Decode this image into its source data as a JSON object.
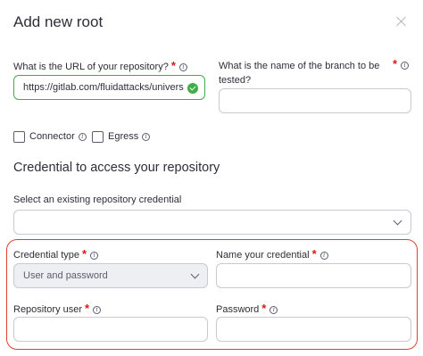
{
  "dialog": {
    "title": "Add new root"
  },
  "repo_url": {
    "label": "What is the URL of your repository?",
    "value": "https://gitlab.com/fluidattacks/universe",
    "required_mark": "*"
  },
  "branch": {
    "label_line1": "What is the name of the branch to be",
    "label_line2": "tested?",
    "value": "",
    "required_mark": "*"
  },
  "options": {
    "connector_label": "Connector",
    "egress_label": "Egress"
  },
  "credential_section": {
    "title": "Credential to access your repository",
    "existing_label": "Select an existing repository credential",
    "existing_value": ""
  },
  "credential_type": {
    "label": "Credential type",
    "value": "User and password",
    "required_mark": "*"
  },
  "credential_name": {
    "label": "Name your credential",
    "value": "",
    "required_mark": "*"
  },
  "repo_user": {
    "label": "Repository user",
    "value": "",
    "required_mark": "*"
  },
  "password": {
    "label": "Password",
    "value": "",
    "required_mark": "*"
  },
  "icons": {
    "info": "i",
    "close": "close-icon",
    "check": "check-circle-icon",
    "chevron": "chevron-down-icon"
  },
  "colors": {
    "valid": "#3fae49",
    "required": "#d41b1b",
    "highlight": "#e0402f"
  }
}
